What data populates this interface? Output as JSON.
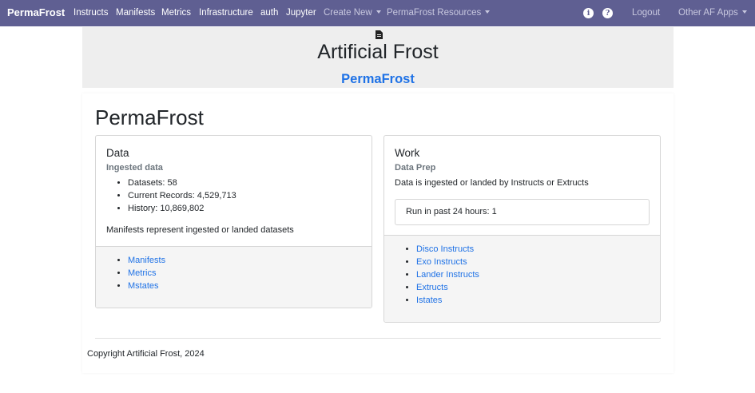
{
  "navbar": {
    "brand": "PermaFrost",
    "items": [
      "Instructs",
      "Manifests",
      "Metrics",
      "Infrastructure",
      "auth",
      "Jupyter"
    ],
    "dropdowns": [
      "Create New",
      "PermaFrost Resources"
    ],
    "info_icon": "i",
    "help_icon": "?",
    "logout": "Logout",
    "other_apps": "Other AF Apps"
  },
  "header": {
    "title": "Artificial Frost",
    "subtitle": "PermaFrost"
  },
  "main": {
    "title": "PermaFrost",
    "data_card": {
      "title": "Data",
      "subtitle": "Ingested data",
      "stats": [
        "Datasets: 58",
        "Current Records: 4,529,713",
        "History: 10,869,802"
      ],
      "text": "Manifests represent ingested or landed datasets",
      "links": [
        "Manifests",
        "Metrics",
        "Mstates"
      ]
    },
    "work_card": {
      "title": "Work",
      "subtitle": "Data Prep",
      "text": "Data is ingested or landed by Instructs or Extructs",
      "run_status": "Run in past 24 hours: 1",
      "links": [
        "Disco Instructs",
        "Exo Instructs",
        "Lander Instructs",
        "Extructs",
        "Istates"
      ]
    },
    "footer": "Copyright Artificial Frost, 2024"
  }
}
